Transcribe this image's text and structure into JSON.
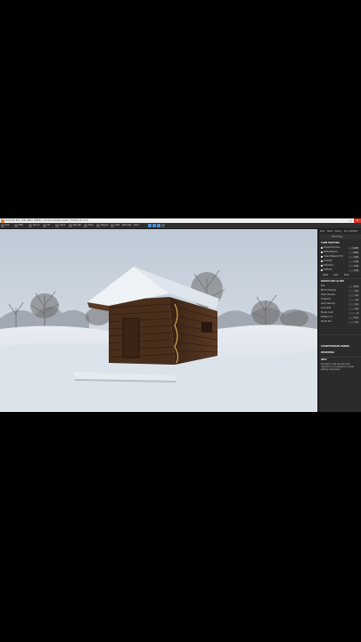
{
  "window": {
    "title": "Corona 10 | 3ds Max 2024 | Corona Scene.max | Frame 0 of 0",
    "buttons": [
      "–",
      "□",
      "✕"
    ]
  },
  "toolbar": {
    "items": [
      "File",
      "Edit",
      "Zoom",
      "Fit",
      "Save",
      "Render",
      "Stop",
      "Region",
      "Post",
      "Denoise"
    ],
    "denoise_value": "4/4 ▾"
  },
  "panel": {
    "tabs": [
      "Post",
      "Stats",
      "History",
      "DR",
      "LightMix"
    ],
    "subheader": "Denoising",
    "sections": [
      {
        "title": "TONE MAPPING",
        "rows": [
          {
            "label": "Simple Exposure",
            "value": "0.000"
          },
          {
            "label": "White Balance",
            "value": "6500"
          },
          {
            "label": "Green-Magenta Tint",
            "value": "0.00"
          },
          {
            "label": "Contrast",
            "value": "1.00"
          },
          {
            "label": "Saturation",
            "value": "0.00"
          },
          {
            "label": "ACES OT",
            "value": "1.00"
          }
        ],
        "actions": [
          "Reset",
          "Load",
          "Save"
        ]
      },
      {
        "title": "BLOOM AND GLARE",
        "rows": [
          {
            "label": "Size",
            "value": "15.0"
          },
          {
            "label": "Bloom intensity",
            "value": "0.0"
          },
          {
            "label": "Glare intensity",
            "value": "0.0"
          },
          {
            "label": "Threshold",
            "value": "1.0"
          },
          {
            "label": "Color intensity",
            "value": "0.3"
          },
          {
            "label": "Color shift",
            "value": "0.0"
          },
          {
            "label": "Streak count",
            "value": "3"
          },
          {
            "label": "Rotation [°]",
            "value": "15.0"
          },
          {
            "label": "Streak blur",
            "value": "0.2"
          }
        ]
      },
      {
        "title": "SHARPENING/BLURRING",
        "rows": []
      },
      {
        "title": "DENOISING",
        "rows": []
      }
    ],
    "info_title": "INFO",
    "info_text": "Denoising: Intel denoiser with resolution 1x is selected in render settings. Denoising..."
  },
  "colors": {
    "accent": "#4d8fd6",
    "close": "#d9342b",
    "panel_bg": "#2b2b2b",
    "sky": "#c9d3de",
    "snow": "#e3e8ee"
  }
}
